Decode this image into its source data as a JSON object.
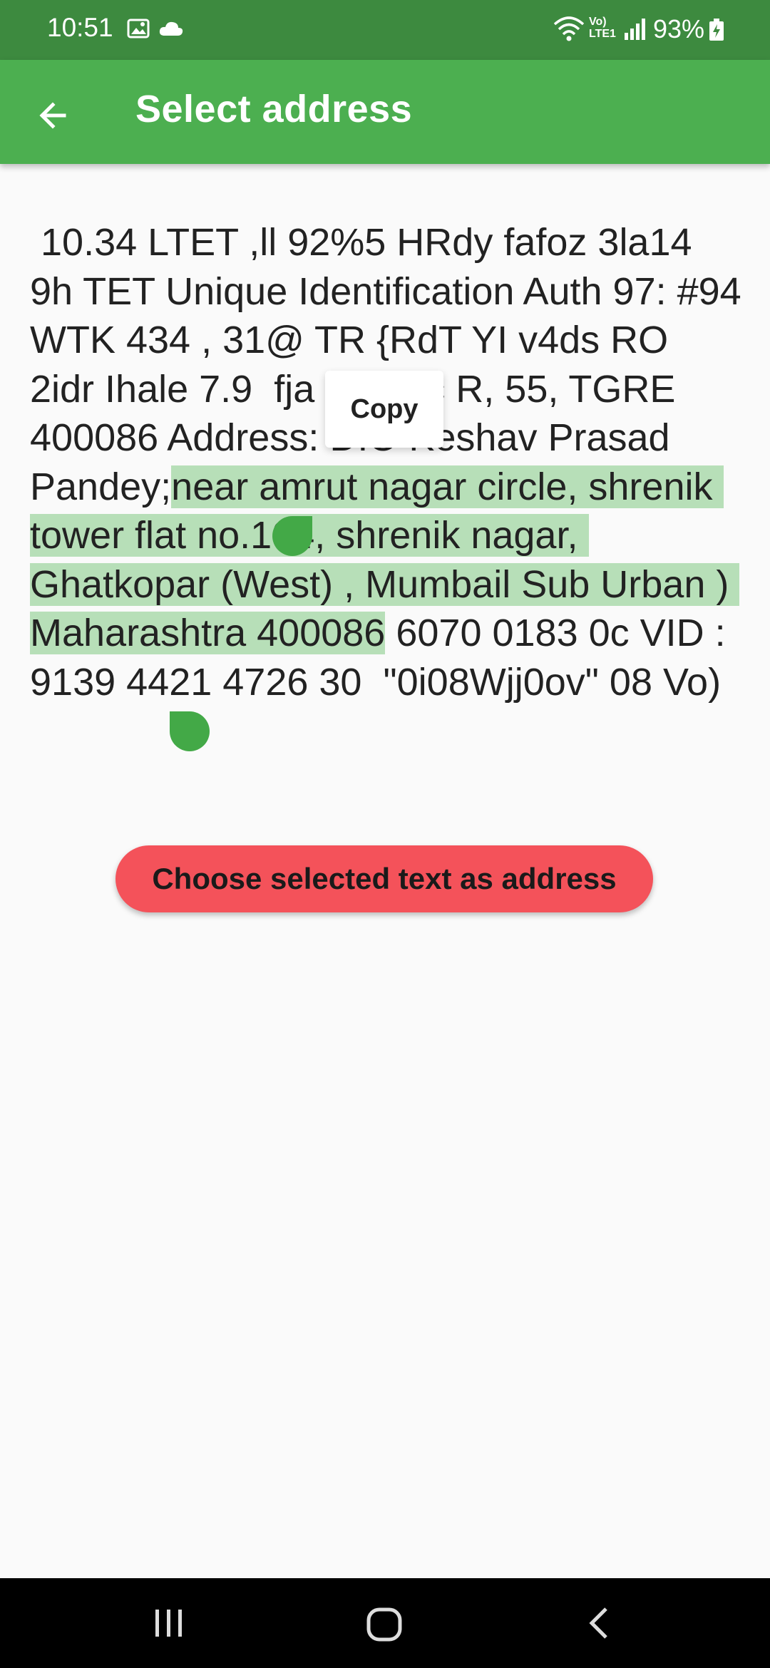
{
  "status_bar": {
    "time": "10:51",
    "volte_line1": "Vo)",
    "volte_line2": "LTE1",
    "battery": "93%",
    "icons": [
      "gallery-icon",
      "cloud-icon",
      "wifi-icon",
      "volte-icon",
      "signal-icon",
      "battery-icon"
    ]
  },
  "app_bar": {
    "title": "Select address",
    "back_icon": "arrow-left-icon",
    "color": "#4caf50"
  },
  "ocr": {
    "text_before": " 10.34 LTET ,ll 92%5 HRdy fafoz 3la14 9h TET Unique Identification Auth 97: #94 WTK 434 , 31@ TR {RdT YI v4ds RO  2idr Ihale 7.9  fja 7R, Tic R, 55, TGRE 400086 Address: DIO Keshav Prasad Pandey;",
    "text_selected": "near amrut nagar circle, shrenik tower flat no.104, shrenik nagar, Ghatkopar (West) , Mumbail Sub Urban ) Maharashtra 400086",
    "text_after": " 6070 0183 0c VID : 9139 4421 4726 30  \"0i08Wjj0ov\" 08 Vo)",
    "selection_color": "#b7dfb8"
  },
  "context_menu": {
    "copy_label": "Copy"
  },
  "action": {
    "choose_label": "Choose selected text as address",
    "color": "#f4525a"
  },
  "nav_bar": {
    "icons": [
      "recents-icon",
      "home-icon",
      "back-icon"
    ]
  }
}
